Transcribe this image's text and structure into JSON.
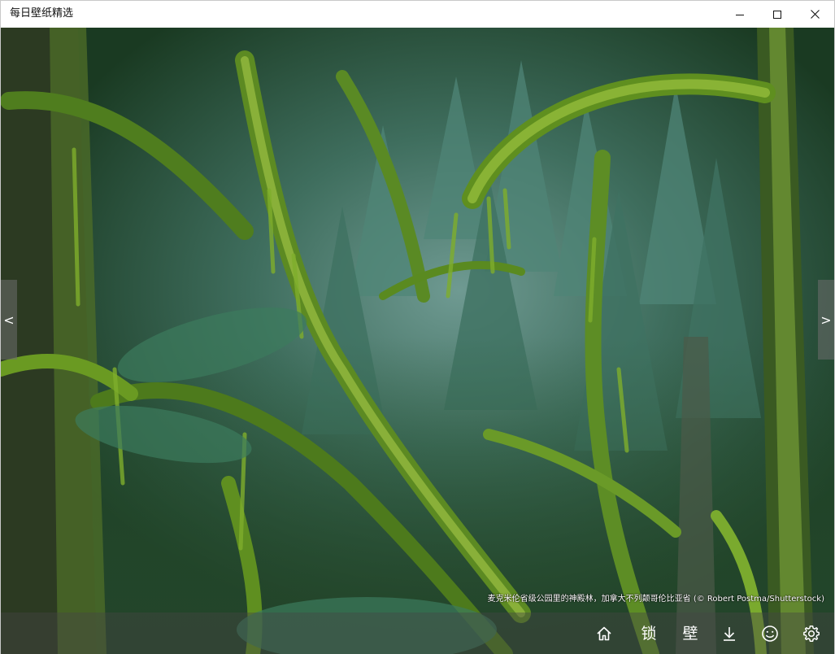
{
  "window": {
    "title": "每日壁纸精选"
  },
  "navigation": {
    "prev_label": "<",
    "next_label": ">"
  },
  "wallpaper": {
    "caption": "麦克米伦省级公园里的神殿林，加拿大不列颠哥伦比亚省 (© Robert Postma/Shutterstock)"
  },
  "toolbar": {
    "lock_label": "锁",
    "wallpaper_label": "壁"
  },
  "icons": {
    "minimize": "minimize-icon",
    "maximize": "maximize-icon",
    "close": "close-icon",
    "home": "home-icon",
    "download": "download-icon",
    "emoji": "smiley-icon",
    "settings": "gear-icon"
  }
}
